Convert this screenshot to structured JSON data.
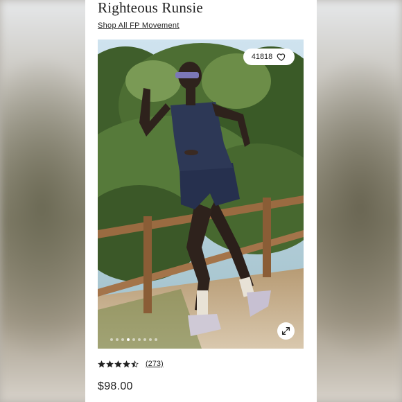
{
  "product": {
    "title": "Righteous Runsie",
    "shop_link": "Shop All FP Movement",
    "favorites_count": "41818",
    "review_count": "(273)",
    "rating": 4.5,
    "price": "$98.00"
  },
  "carousel": {
    "total_slides": 9,
    "active_slide": 3
  },
  "icons": {
    "favorite": "heart-icon",
    "expand": "expand-icon",
    "rating": "star-icon"
  },
  "colors": {
    "text": "#1f1f1f",
    "card_bg": "#ffffff",
    "stars": "#222222"
  }
}
